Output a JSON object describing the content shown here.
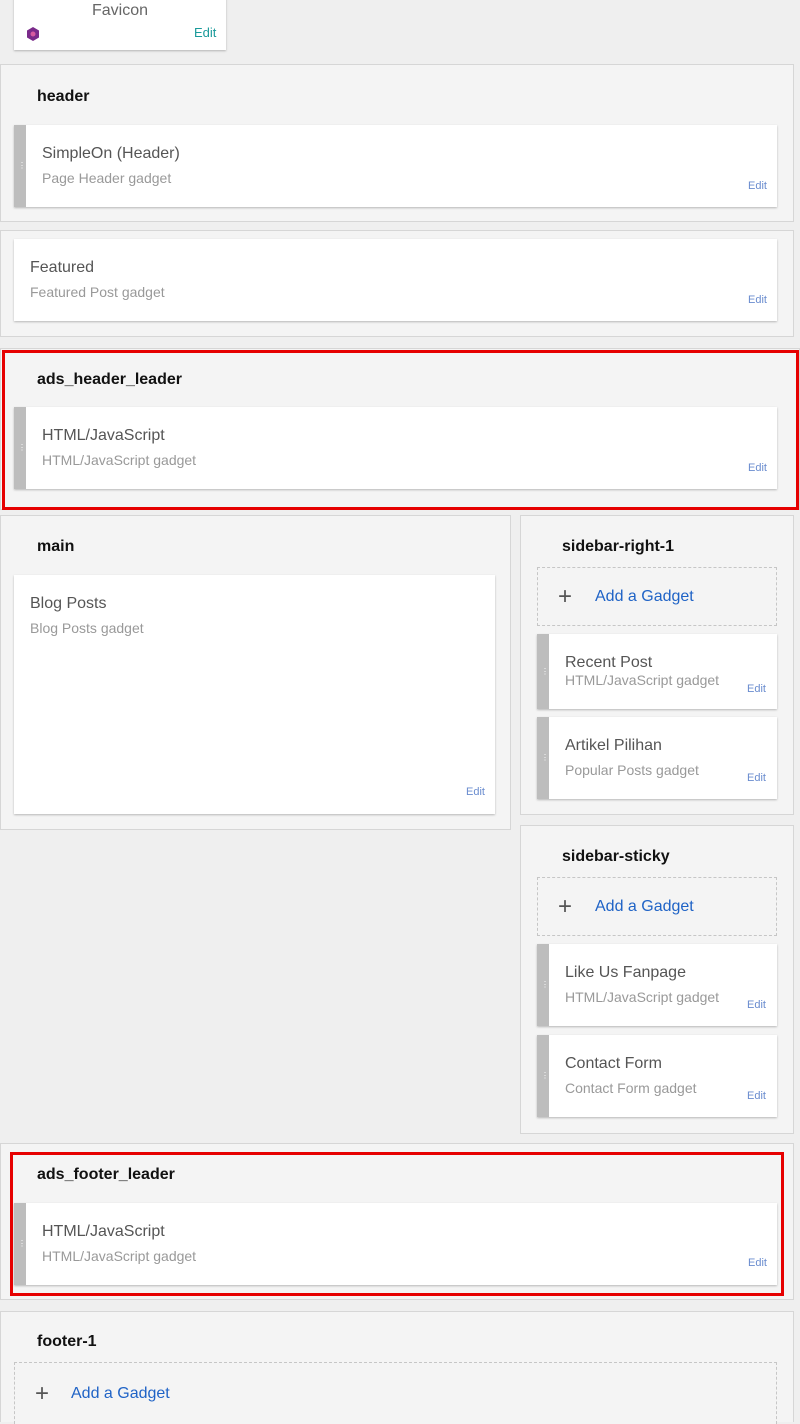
{
  "favicon": {
    "title": "Favicon",
    "edit": "Edit"
  },
  "header": {
    "title": "header",
    "gadget": {
      "title": "SimpleOn (Header)",
      "subtitle": "Page Header gadget",
      "edit": "Edit"
    }
  },
  "featured": {
    "gadget": {
      "title": "Featured",
      "subtitle": "Featured Post gadget",
      "edit": "Edit"
    }
  },
  "ads_header_leader": {
    "title": "ads_header_leader",
    "gadget": {
      "title": "HTML/JavaScript",
      "subtitle": "HTML/JavaScript gadget",
      "edit": "Edit"
    }
  },
  "main": {
    "title": "main",
    "gadget": {
      "title": "Blog Posts",
      "subtitle": "Blog Posts gadget",
      "edit": "Edit"
    }
  },
  "sidebar_right_1": {
    "title": "sidebar-right-1",
    "add_label": "Add a Gadget",
    "gadgets": [
      {
        "title": "Recent Post",
        "subtitle": "HTML/JavaScript gadget",
        "edit": "Edit"
      },
      {
        "title": "Artikel Pilihan",
        "subtitle": "Popular Posts gadget",
        "edit": "Edit"
      }
    ]
  },
  "sidebar_sticky": {
    "title": "sidebar-sticky",
    "add_label": "Add a Gadget",
    "gadgets": [
      {
        "title": "Like Us Fanpage",
        "subtitle": "HTML/JavaScript gadget",
        "edit": "Edit"
      },
      {
        "title": "Contact Form",
        "subtitle": "Contact Form gadget",
        "edit": "Edit"
      }
    ]
  },
  "ads_footer_leader": {
    "title": "ads_footer_leader",
    "gadget": {
      "title": "HTML/JavaScript",
      "subtitle": "HTML/JavaScript gadget",
      "edit": "Edit"
    }
  },
  "footer_1": {
    "title": "footer-1",
    "add_label": "Add a Gadget"
  },
  "colors": {
    "accent_link": "#1f63c6",
    "highlight": "#e60000",
    "edit_link": "#6a8ccf",
    "teal_edit": "#1a9a9a"
  }
}
